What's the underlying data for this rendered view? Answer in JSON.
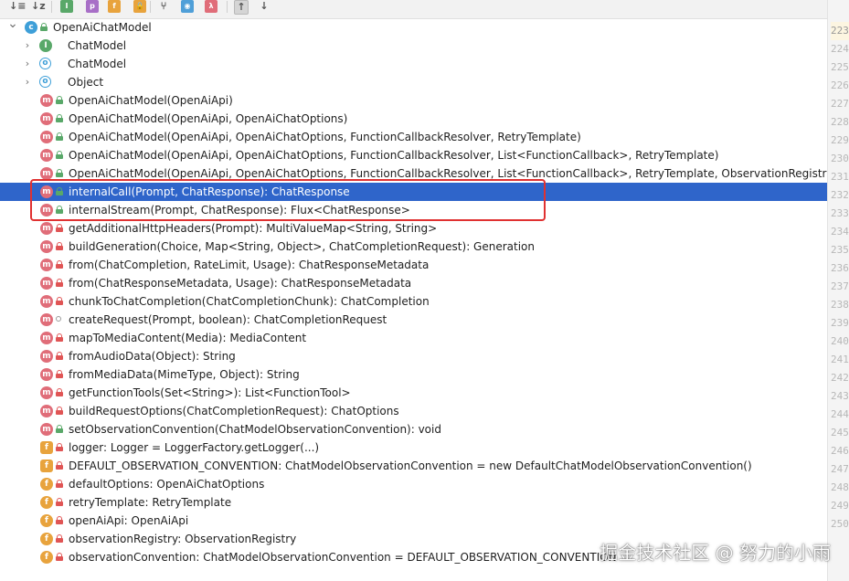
{
  "toolbar": {
    "buttons": [
      {
        "name": "sort-by-visibility-icon",
        "glyph": "↓≡",
        "kind": "glyph"
      },
      {
        "name": "sort-alphabetically-icon",
        "glyph": "↓z",
        "kind": "glyph"
      },
      {
        "name": "show-interfaces-icon",
        "glyph": "I",
        "kind": "filter",
        "color": "#59a869"
      },
      {
        "name": "show-properties-icon",
        "glyph": "p",
        "kind": "filter",
        "color": "#a86fc7"
      },
      {
        "name": "show-fields-icon",
        "glyph": "f",
        "kind": "filter",
        "color": "#e8a33d"
      },
      {
        "name": "show-non-public-icon",
        "glyph": "🔒",
        "kind": "filter",
        "color": "#e8a33d"
      },
      {
        "name": "show-inherited-icon",
        "glyph": "⑂",
        "kind": "glyph"
      },
      {
        "name": "show-anonymous-classes-icon",
        "glyph": "◉",
        "kind": "filter",
        "color": "#4f9fd8"
      },
      {
        "name": "show-lambdas-icon",
        "glyph": "λ",
        "kind": "filter",
        "color": "#e06d79"
      },
      {
        "name": "expand-all-icon",
        "glyph": "↑",
        "kind": "pressed"
      },
      {
        "name": "collapse-all-icon",
        "glyph": "↓",
        "kind": "glyph"
      }
    ]
  },
  "colors": {
    "method": "#e06d79",
    "field": "#e8a33d",
    "class": "#3e9fd8",
    "interface": "#59a869",
    "selection": "#2f65ca",
    "highlight": "#e03131"
  },
  "tree": [
    {
      "level": 0,
      "chevron": "expanded",
      "icon": "class",
      "icon_glyph": "c",
      "visibility": "public",
      "label": "OpenAiChatModel"
    },
    {
      "level": 1,
      "chevron": "collapsed",
      "icon": "interface",
      "icon_glyph": "I",
      "visibility": "none",
      "label": "ChatModel"
    },
    {
      "level": 1,
      "chevron": "collapsed",
      "icon": "class-outline",
      "icon_glyph": "o",
      "visibility": "none",
      "label": "ChatModel"
    },
    {
      "level": 1,
      "chevron": "collapsed",
      "icon": "class-outline",
      "icon_glyph": "o",
      "visibility": "none",
      "label": "Object"
    },
    {
      "level": 2,
      "icon": "method",
      "icon_glyph": "m",
      "visibility": "public",
      "label": "OpenAiChatModel(OpenAiApi)"
    },
    {
      "level": 2,
      "icon": "method",
      "icon_glyph": "m",
      "visibility": "public",
      "label": "OpenAiChatModel(OpenAiApi, OpenAiChatOptions)"
    },
    {
      "level": 2,
      "icon": "method",
      "icon_glyph": "m",
      "visibility": "public",
      "label": "OpenAiChatModel(OpenAiApi, OpenAiChatOptions, FunctionCallbackResolver, RetryTemplate)"
    },
    {
      "level": 2,
      "icon": "method",
      "icon_glyph": "m",
      "visibility": "public",
      "label": "OpenAiChatModel(OpenAiApi, OpenAiChatOptions, FunctionCallbackResolver, List<FunctionCallback>, RetryTemplate)"
    },
    {
      "level": 2,
      "icon": "method",
      "icon_glyph": "m",
      "visibility": "public",
      "label": "OpenAiChatModel(OpenAiApi, OpenAiChatOptions, FunctionCallbackResolver, List<FunctionCallback>, RetryTemplate, ObservationRegistry)"
    },
    {
      "level": 2,
      "icon": "method",
      "icon_glyph": "m",
      "visibility": "public",
      "label": "internalCall(Prompt, ChatResponse): ChatResponse",
      "selected": true
    },
    {
      "level": 2,
      "icon": "method",
      "icon_glyph": "m",
      "visibility": "public",
      "label": "internalStream(Prompt, ChatResponse): Flux<ChatResponse>"
    },
    {
      "level": 2,
      "icon": "method",
      "icon_glyph": "m",
      "visibility": "private",
      "label": "getAdditionalHttpHeaders(Prompt): MultiValueMap<String, String>"
    },
    {
      "level": 2,
      "icon": "method",
      "icon_glyph": "m",
      "visibility": "private",
      "label": "buildGeneration(Choice, Map<String, Object>, ChatCompletionRequest): Generation"
    },
    {
      "level": 2,
      "icon": "method",
      "icon_glyph": "m",
      "visibility": "private",
      "label": "from(ChatCompletion, RateLimit, Usage): ChatResponseMetadata"
    },
    {
      "level": 2,
      "icon": "method",
      "icon_glyph": "m",
      "visibility": "private",
      "label": "from(ChatResponseMetadata, Usage): ChatResponseMetadata"
    },
    {
      "level": 2,
      "icon": "method",
      "icon_glyph": "m",
      "visibility": "private",
      "label": "chunkToChatCompletion(ChatCompletionChunk): ChatCompletion"
    },
    {
      "level": 2,
      "icon": "method",
      "icon_glyph": "m",
      "visibility": "package",
      "label": "createRequest(Prompt, boolean): ChatCompletionRequest"
    },
    {
      "level": 2,
      "icon": "method",
      "icon_glyph": "m",
      "visibility": "private",
      "label": "mapToMediaContent(Media): MediaContent"
    },
    {
      "level": 2,
      "icon": "method",
      "icon_glyph": "m",
      "visibility": "private",
      "label": "fromAudioData(Object): String"
    },
    {
      "level": 2,
      "icon": "method",
      "icon_glyph": "m",
      "visibility": "private",
      "label": "fromMediaData(MimeType, Object): String"
    },
    {
      "level": 2,
      "icon": "method",
      "icon_glyph": "m",
      "visibility": "private",
      "label": "getFunctionTools(Set<String>): List<FunctionTool>"
    },
    {
      "level": 2,
      "icon": "method",
      "icon_glyph": "m",
      "visibility": "private",
      "label": "buildRequestOptions(ChatCompletionRequest): ChatOptions"
    },
    {
      "level": 2,
      "icon": "method",
      "icon_glyph": "m",
      "visibility": "public",
      "label": "setObservationConvention(ChatModelObservationConvention): void"
    },
    {
      "level": 2,
      "icon": "field-static",
      "icon_glyph": "f",
      "visibility": "private",
      "label": "logger: Logger = LoggerFactory.getLogger(...)"
    },
    {
      "level": 2,
      "icon": "field-static",
      "icon_glyph": "f",
      "visibility": "private",
      "label": "DEFAULT_OBSERVATION_CONVENTION: ChatModelObservationConvention = new DefaultChatModelObservationConvention()"
    },
    {
      "level": 2,
      "icon": "field",
      "icon_glyph": "f",
      "visibility": "private",
      "label": "defaultOptions: OpenAiChatOptions"
    },
    {
      "level": 2,
      "icon": "field",
      "icon_glyph": "f",
      "visibility": "private",
      "label": "retryTemplate: RetryTemplate"
    },
    {
      "level": 2,
      "icon": "field",
      "icon_glyph": "f",
      "visibility": "private",
      "label": "openAiApi: OpenAiApi"
    },
    {
      "level": 2,
      "icon": "field",
      "icon_glyph": "f",
      "visibility": "private",
      "label": "observationRegistry: ObservationRegistry"
    },
    {
      "level": 2,
      "icon": "field",
      "icon_glyph": "f",
      "visibility": "private",
      "label": "observationConvention: ChatModelObservationConvention = DEFAULT_OBSERVATION_CONVENTION"
    }
  ],
  "gutter": {
    "line_numbers": [
      "223",
      "224",
      "225",
      "226",
      "227",
      "228",
      "229",
      "230",
      "231",
      "232",
      "233",
      "234",
      "235",
      "236",
      "237",
      "238",
      "239",
      "240",
      "241",
      "242",
      "243",
      "244",
      "245",
      "246",
      "247",
      "248",
      "249",
      "250"
    ],
    "current_line": "223"
  },
  "watermark": "掘金技术社区 @ 努力的小雨"
}
